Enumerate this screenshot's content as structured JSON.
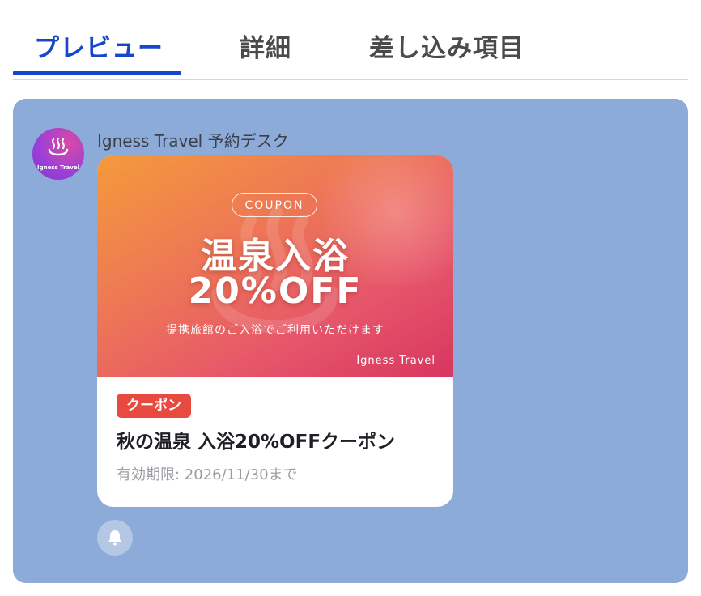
{
  "tabs": [
    {
      "label": "プレビュー",
      "active": true
    },
    {
      "label": "詳細",
      "active": false
    },
    {
      "label": "差し込み項目",
      "active": false
    }
  ],
  "colors": {
    "accent": "#1647c8",
    "panel_bg": "#8dabd9",
    "badge_bg": "#e84a3f"
  },
  "message": {
    "sender_name": "Igness Travel 予約デスク",
    "avatar": {
      "icon": "onsen-icon",
      "text": "Igness Travel"
    },
    "card": {
      "hero": {
        "pill": "COUPON",
        "title_line1": "温泉入浴",
        "title_line2": "20%OFF",
        "subtitle": "提携旅館のご入浴でご利用いただけます",
        "brand": "Igness Travel"
      },
      "badge": "クーポン",
      "title": "秋の温泉 入浴20%OFFクーポン",
      "expiry": "有効期限: 2026/11/30まで"
    },
    "notification_icon": "bell-icon"
  }
}
